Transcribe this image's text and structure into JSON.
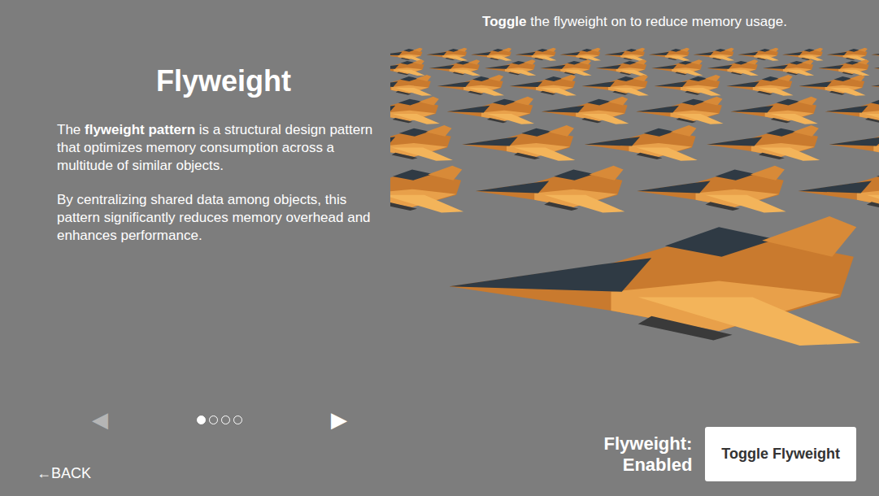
{
  "title": "Flyweight",
  "paragraphs": [
    [
      {
        "text": "The ",
        "bold": false
      },
      {
        "text": "flyweight pattern",
        "bold": true
      },
      {
        "text": " is a structural design pattern that optimizes memory consumption across a multitude of similar objects.",
        "bold": false
      }
    ],
    [
      {
        "text": "By centralizing shared data among objects, this pattern significantly reduces memory overhead and enhances performance.",
        "bold": false
      }
    ]
  ],
  "pager": {
    "prev": {
      "text": "◀",
      "disabled": true
    },
    "next": {
      "text": "▶",
      "disabled": false
    },
    "dots": [
      {
        "selected": true
      },
      {
        "selected": false
      },
      {
        "selected": false
      },
      {
        "selected": false
      }
    ]
  },
  "back": "←BACK",
  "hint": [
    {
      "text": "Toggle",
      "bold": true
    },
    {
      "text": " the flyweight on to reduce memory usage.",
      "bold": false
    }
  ],
  "status": {
    "label": "Flyweight:",
    "value": "Enabled"
  },
  "button": "Toggle Flyweight"
}
